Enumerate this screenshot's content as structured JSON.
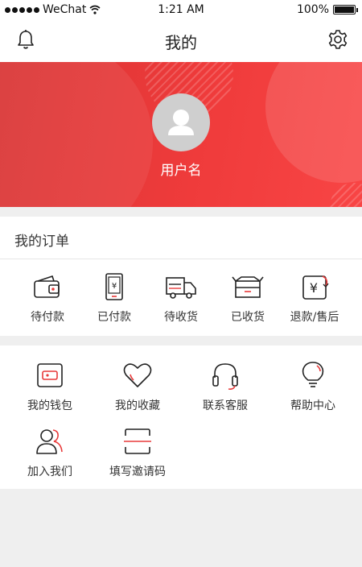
{
  "status_bar": {
    "carrier": "WeChat",
    "time": "1:21 AM",
    "battery": "100%"
  },
  "nav": {
    "title": "我的",
    "left_icon": "bell-icon",
    "right_icon": "gear-icon"
  },
  "profile": {
    "username": "用户名"
  },
  "orders": {
    "title": "我的订单",
    "items": [
      {
        "label": "待付款",
        "icon": "wallet-icon"
      },
      {
        "label": "已付款",
        "icon": "paid-phone-icon"
      },
      {
        "label": "待收货",
        "icon": "truck-icon"
      },
      {
        "label": "已收货",
        "icon": "box-icon"
      },
      {
        "label": "退款/售后",
        "icon": "refund-icon"
      }
    ]
  },
  "services": {
    "items": [
      {
        "label": "我的钱包",
        "icon": "wallet-icon"
      },
      {
        "label": "我的收藏",
        "icon": "heart-icon"
      },
      {
        "label": "联系客服",
        "icon": "headset-icon"
      },
      {
        "label": "帮助中心",
        "icon": "bulb-icon"
      },
      {
        "label": "加入我们",
        "icon": "people-icon"
      },
      {
        "label": "填写邀请码",
        "icon": "scan-icon"
      }
    ]
  },
  "colors": {
    "brand_red": "#ef3b3b",
    "accent_red": "#e83a3a",
    "page_bg": "#efefef"
  }
}
